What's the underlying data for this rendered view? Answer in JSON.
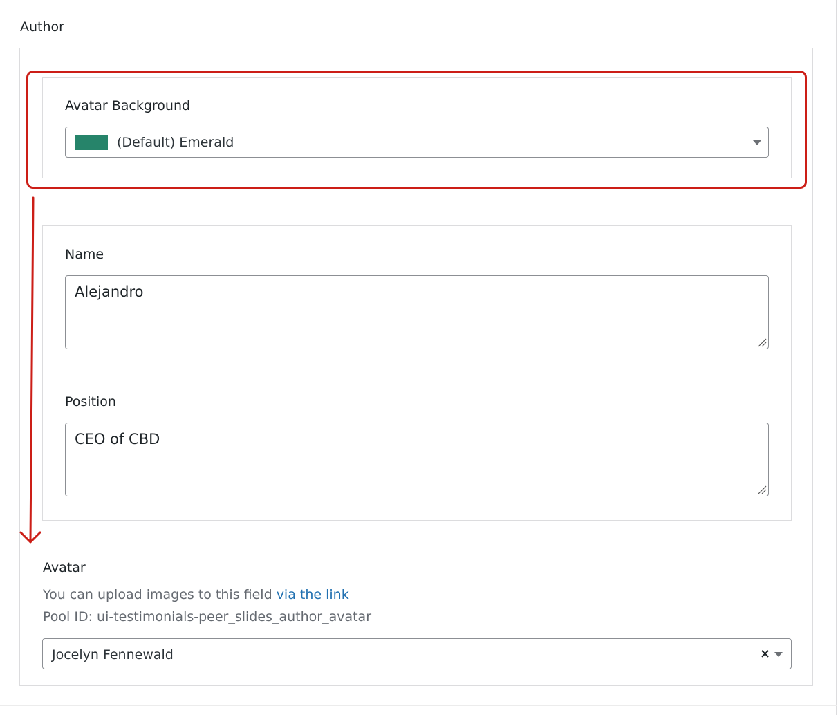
{
  "section": {
    "title": "Author"
  },
  "avatar_background": {
    "label": "Avatar Background",
    "selected": "(Default) Emerald",
    "swatch_color": "#26846a"
  },
  "name_field": {
    "label": "Name",
    "value": "Alejandro"
  },
  "position_field": {
    "label": "Position",
    "value": "CEO of CBD"
  },
  "avatar": {
    "label": "Avatar",
    "help_prefix": "You can upload images to this field ",
    "help_link": "via the link",
    "pool_id": "Pool ID: ui-testimonials-peer_slides_author_avatar",
    "selected": "Jocelyn Fennewald",
    "clear_symbol": "×"
  },
  "colors": {
    "annotation": "#cc1e17",
    "link": "#2271b1"
  }
}
